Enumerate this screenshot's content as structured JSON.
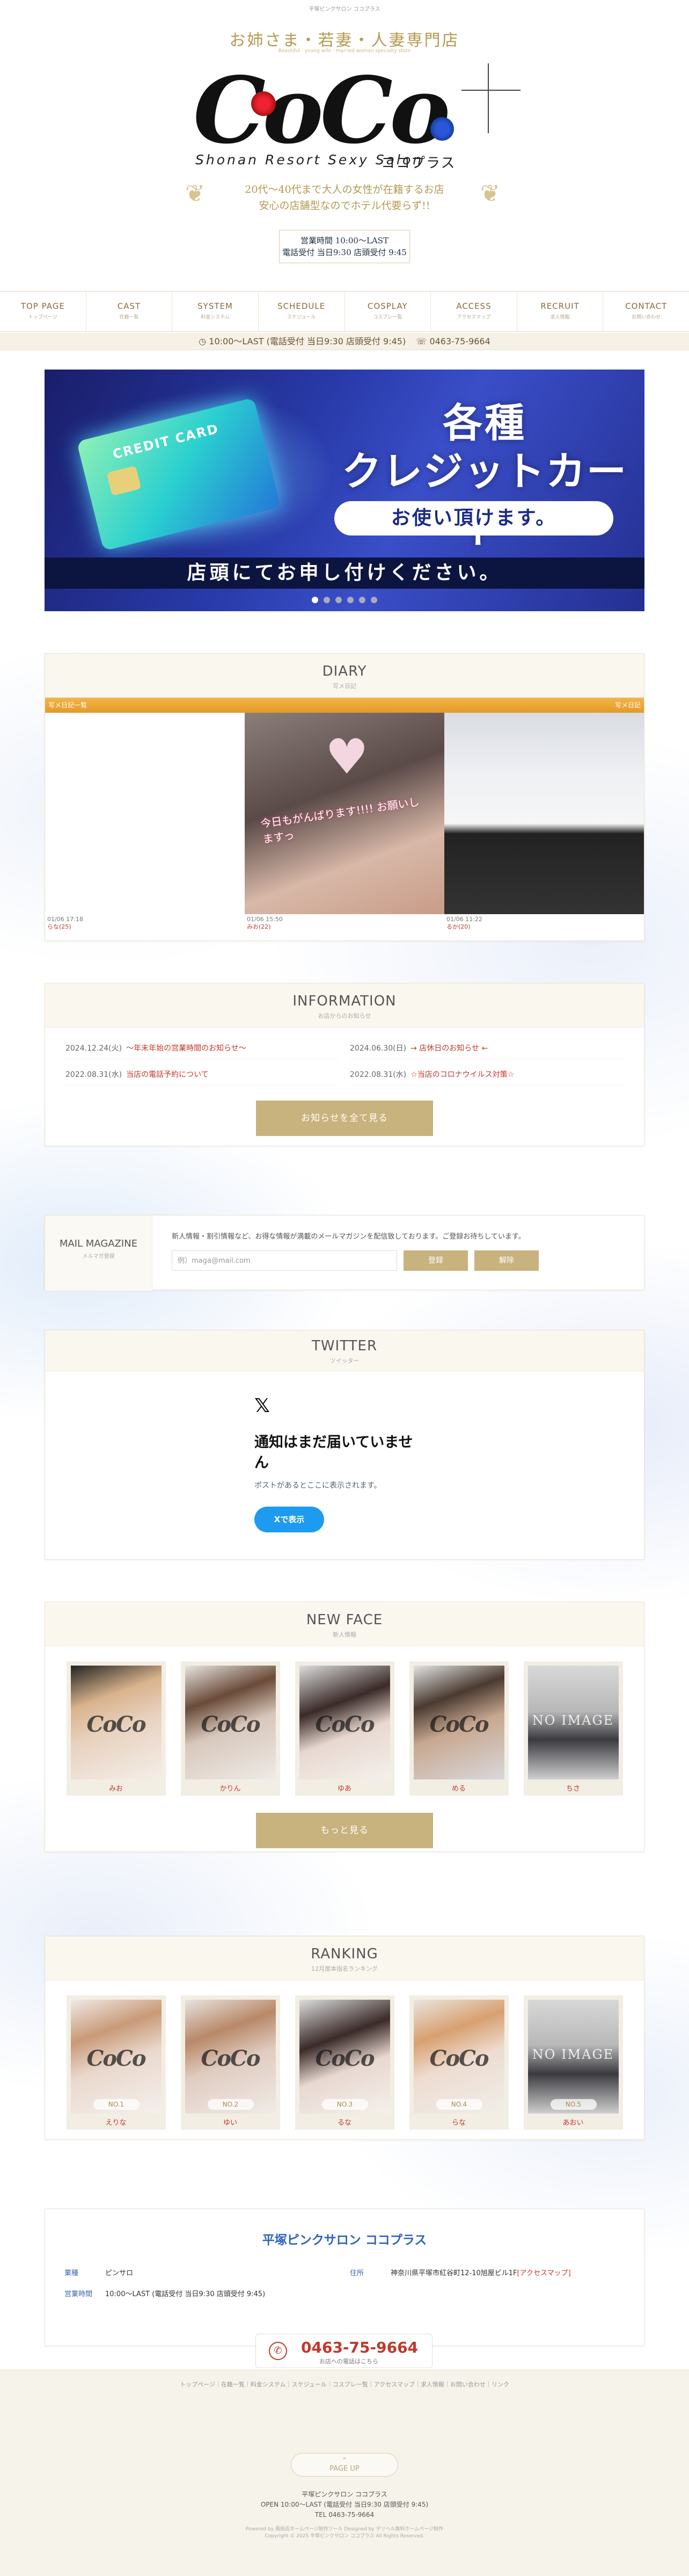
{
  "header": {
    "top_note": "平塚ピンクサロン ココプラス",
    "tagline": "お姉さま・若妻・人妻専門店",
    "tagline_small": "Beautiful · young wife · married woman specialty store",
    "logo_text": "CoCo",
    "logo_sub": "Shonan Resort Sexy Salon",
    "logo_kana": "ココプラス",
    "intro1": "20代～40代まで大人の女性が在籍するお店",
    "intro2": "安心の店舗型なのでホテル代要らず!!",
    "hours1": "営業時間 10:00～LAST",
    "hours2": "電話受付 当日9:30 店頭受付 9:45"
  },
  "nav": [
    {
      "en": "TOP PAGE",
      "ja": "トップページ"
    },
    {
      "en": "CAST",
      "ja": "在籍一覧"
    },
    {
      "en": "SYSTEM",
      "ja": "料金システム"
    },
    {
      "en": "SCHEDULE",
      "ja": "スケジュール"
    },
    {
      "en": "COSPLAY",
      "ja": "コスプレ一覧"
    },
    {
      "en": "ACCESS",
      "ja": "アクセスマップ"
    },
    {
      "en": "RECRUIT",
      "ja": "求人情報"
    },
    {
      "en": "CONTACT",
      "ja": "お問い合わせ"
    }
  ],
  "info_bar": {
    "hours": "10:00～LAST (電話受付 当日9:30 店頭受付 9:45)",
    "tel": "0463-75-9664"
  },
  "banner": {
    "card_label": "CREDIT CARD",
    "line1": "各種",
    "line2": "クレジットカード",
    "pill": "お使い頂けます。",
    "footer": "店頭にてお申し付けください。"
  },
  "diary": {
    "title": "DIARY",
    "subtitle": "写メ日記",
    "bar_left": "写メ日記一覧",
    "bar_right": "写メ日記",
    "entries": [
      {
        "date": "01/06 17:18",
        "name": "らな(25)"
      },
      {
        "date": "01/06 15:50",
        "name": "みお(22)"
      },
      {
        "date": "01/06 11:22",
        "name": "るか(20)"
      }
    ],
    "photo_text": "今日もがんばります!!!! お願いしますっ"
  },
  "information": {
    "title": "INFORMATION",
    "subtitle": "お店からのお知らせ",
    "items": [
      {
        "date": "2024.12.24(火)",
        "text": "～年末年始の営業時間のお知らせ～"
      },
      {
        "date": "2024.06.30(日)",
        "text": "→ 店休日のお知らせ ←"
      },
      {
        "date": "2022.08.31(水)",
        "text": "当店の電話予約について"
      },
      {
        "date": "2022.08.31(水)",
        "text": "☆当店のコロナウイルス対策☆"
      }
    ],
    "button": "お知らせを全て見る"
  },
  "mail": {
    "title": "MAIL MAGAZINE",
    "subtitle": "メルマガ登録",
    "desc": "新人情報・割引情報など、お得な情報が満載のメールマガジンを配信致しております。ご登録お待ちしています。",
    "placeholder": "例）maga@mail.com",
    "register": "登録",
    "cancel": "解除"
  },
  "twitter": {
    "title": "TWITTER",
    "subtitle": "ツイッター",
    "logo": "𝕏",
    "heading": "通知はまだ届いていません",
    "sub": "ポストがあるとここに表示されます。",
    "button": "Xで表示"
  },
  "newface": {
    "title": "NEW FACE",
    "subtitle": "新人情報",
    "girls": [
      {
        "name": "みお"
      },
      {
        "name": "かりん"
      },
      {
        "name": "ゆあ"
      },
      {
        "name": "める"
      },
      {
        "name": "ちさ"
      }
    ],
    "button": "もっと見る"
  },
  "ranking": {
    "title": "RANKING",
    "subtitle": "12月度本指名ランキング",
    "girls": [
      {
        "rank": "NO.1",
        "name": "えりな"
      },
      {
        "rank": "NO.2",
        "name": "ゆい"
      },
      {
        "rank": "NO.3",
        "name": "るな"
      },
      {
        "rank": "NO.4",
        "name": "らな"
      },
      {
        "rank": "NO.5",
        "name": "あおい"
      }
    ]
  },
  "no_image": "NO IMAGE",
  "shop": {
    "title": "平塚ピンクサロン ココプラス",
    "type_label": "業種",
    "type": "ピンサロ",
    "addr_label": "住所",
    "addr": "神奈川県平塚市紅谷町12-10旭屋ビル1F",
    "map_link": "[アクセスマップ]",
    "hours_label": "営業時間",
    "hours": "10:00～LAST (電話受付 当日9:30 店頭受付 9:45)",
    "tel": "0463-75-9664",
    "tel_sub": "お店への電話はこちら"
  },
  "footer": {
    "links": "トップページ｜在籍一覧｜料金システム｜スケジュール｜コスプレ一覧｜アクセスマップ｜求人情報｜お問い合わせ｜リンク",
    "pageup": "PAGE UP",
    "name": "平塚ピンクサロン ココプラス",
    "open": "OPEN 10:00～LAST (電話受付 当日9:30 店頭受付 9:45)",
    "tel": "TEL 0463-75-9664",
    "powered": "Powered by 風俗店ホームページ制作ツール Designed by デリヘル無料ホームページ制作",
    "copy": "Copyright © 2025 平塚ピンクサロン ココプラス All Rights Reserved."
  }
}
